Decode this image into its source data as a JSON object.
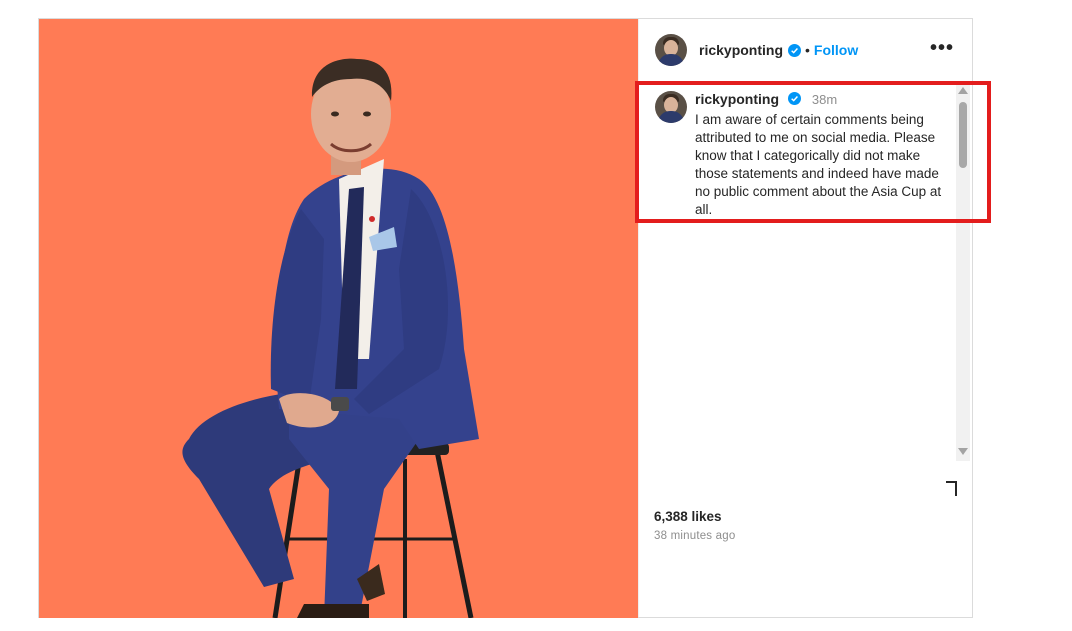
{
  "post": {
    "author": {
      "username": "rickyponting",
      "follow_label": "Follow",
      "dot": "•",
      "more_label": "•••"
    },
    "caption": {
      "username": "rickyponting",
      "time": "38m",
      "text": "I am aware of certain comments being attributed to me on social media. Please know that I categorically did not make those statements and indeed have made no public comment about the Asia Cup at all."
    },
    "likes": "6,388 likes",
    "posted_ago": "38 minutes ago"
  },
  "colors": {
    "photo_background": "#ff7b55",
    "follow": "#0095f6",
    "verified": "#0095f6",
    "highlight": "#e31d1d"
  },
  "icons": [
    "verified-badge-icon",
    "more-options-icon",
    "save-bookmark-icon",
    "scroll-up-arrow",
    "scroll-down-arrow"
  ]
}
